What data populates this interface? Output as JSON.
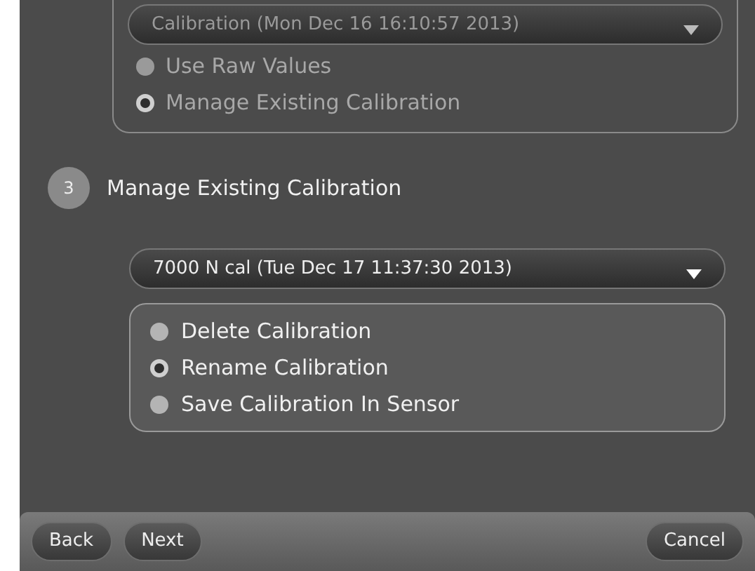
{
  "previous_step": {
    "disabled": true,
    "dropdown": {
      "value": "Calibration (Mon Dec 16 16:10:57 2013)"
    },
    "options": [
      {
        "label": "Use Raw Values",
        "selected": false
      },
      {
        "label": "Manage Existing Calibration",
        "selected": true
      }
    ]
  },
  "step": {
    "number": "3",
    "title": "Manage Existing Calibration"
  },
  "dropdown": {
    "value": "7000 N cal (Tue Dec 17 11:37:30 2013)"
  },
  "options": [
    {
      "label": "Delete Calibration",
      "selected": false
    },
    {
      "label": "Rename Calibration",
      "selected": true
    },
    {
      "label": "Save Calibration In Sensor",
      "selected": false
    }
  ],
  "footer": {
    "buttons": [
      {
        "label": "Back",
        "kind": "left"
      },
      {
        "label": "Next",
        "kind": "left"
      },
      {
        "label": "Cancel",
        "kind": "right"
      }
    ]
  }
}
